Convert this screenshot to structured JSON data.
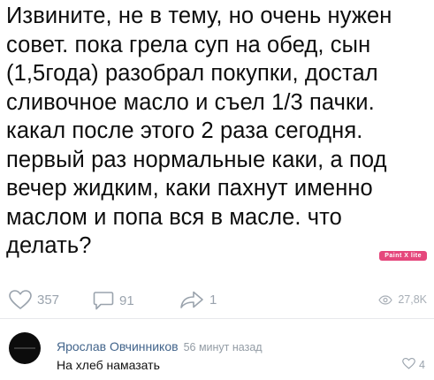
{
  "post": {
    "text": "Извините, не в тему, но очень нужен\nсовет. пока грела суп на обед, сын\n(1,5года) разобрал покупки, достал\nсливочное масло и съел 1/3 пачки.\nкакал после этого 2 раза сегодня.\nпервый раз нормальные каки, а под\nвечер жидким, каки пахнут именно\nмаслом и попа вся в масле. что\nделать?",
    "watermark": "Paint X lite"
  },
  "actions": {
    "likes": "357",
    "comments": "91",
    "shares": "1",
    "views": "27,8K"
  },
  "comment": {
    "author": "Ярослав Овчинников",
    "time": "56 минут назад",
    "text": "На хлеб намазать",
    "likes": "4"
  },
  "colors": {
    "author_link": "#42648b",
    "muted": "#9aa3ad",
    "watermark_bg": "#e5477c"
  }
}
